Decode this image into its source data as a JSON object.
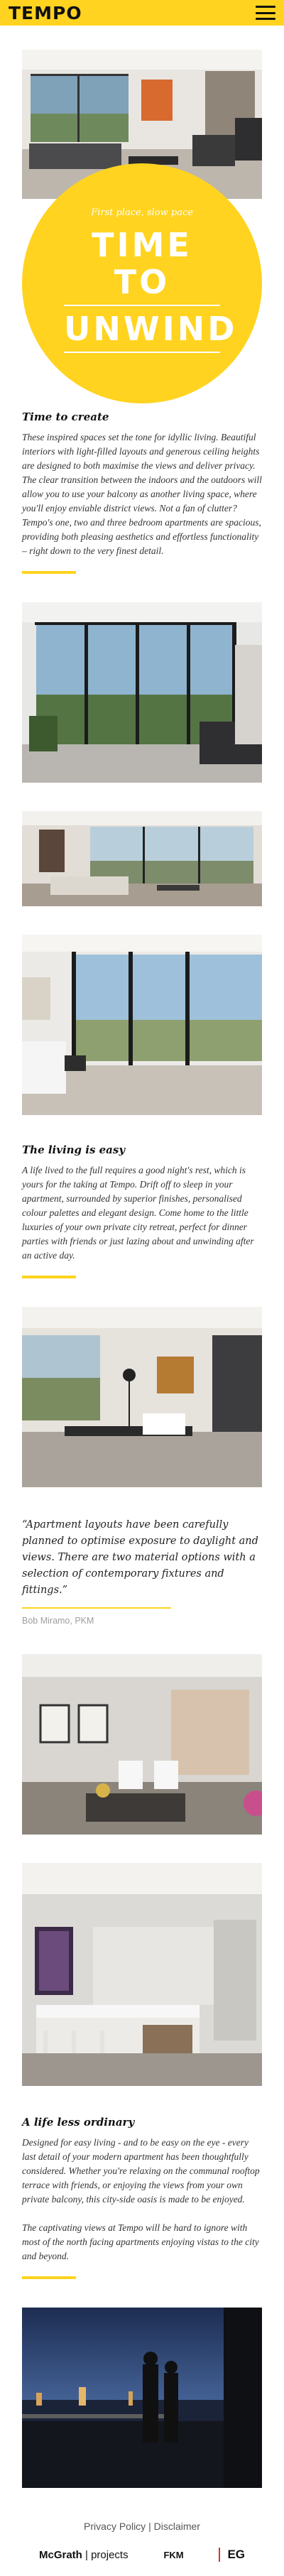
{
  "header": {
    "brand": "TEMPO"
  },
  "hero": {
    "kicker": "First place, slow pace",
    "title_line1": "TIME TO",
    "title_line2": "UNWIND"
  },
  "sections": {
    "create": {
      "heading": "Time to create",
      "body": "These inspired spaces set the tone for idyllic living. Beautiful interiors with light-filled layouts and generous ceiling heights are designed to both maximise the views and deliver privacy. The clear transition between the indoors and the outdoors will allow you to use your balcony as another living space, where you'll enjoy enviable district views. Not a fan of clutter? Tempo's one, two and three bedroom apartments are spacious, providing both pleasing aesthetics and effortless functionality – right down to the very finest detail."
    },
    "easy": {
      "heading": "The living is easy",
      "body": "A life lived to the full requires a good night's rest, which is yours for the taking at Tempo. Drift off to sleep in your apartment, surrounded by superior finishes, personalised colour palettes and elegant design. Come home to the little luxuries of your own private city retreat, perfect for dinner parties with friends or just lazing about and unwinding after an active day."
    },
    "quote": {
      "text": "“Apartment layouts have been carefully planned to optimise exposure to daylight and views. There are two material options with a selection of contemporary fixtures and fittings.”",
      "author": "Bob Miramo, PKM"
    },
    "ordinary": {
      "heading": "A life less ordinary",
      "body1": "Designed for easy living - and to be easy on the eye - every last detail of your modern apartment has been thoughtfully considered. Whether you're relaxing on the communal rooftop terrace with friends, or enjoying the views from your own private balcony, this city-side oasis is made to be enjoyed.",
      "body2": "The captivating views at Tempo will be hard to ignore with most of the north facing apartments enjoying vistas to the city and beyond."
    }
  },
  "footer": {
    "privacy": "Privacy Policy",
    "separator": "|",
    "disclaimer": "Disclaimer",
    "logo_mcgrath": "McGrath",
    "logo_projects": "projects",
    "logo_fkm": "FKM",
    "logo_eg": "EG"
  },
  "colors": {
    "accent": "#ffd31f",
    "text": "#333333",
    "muted": "#9d9d9d"
  }
}
